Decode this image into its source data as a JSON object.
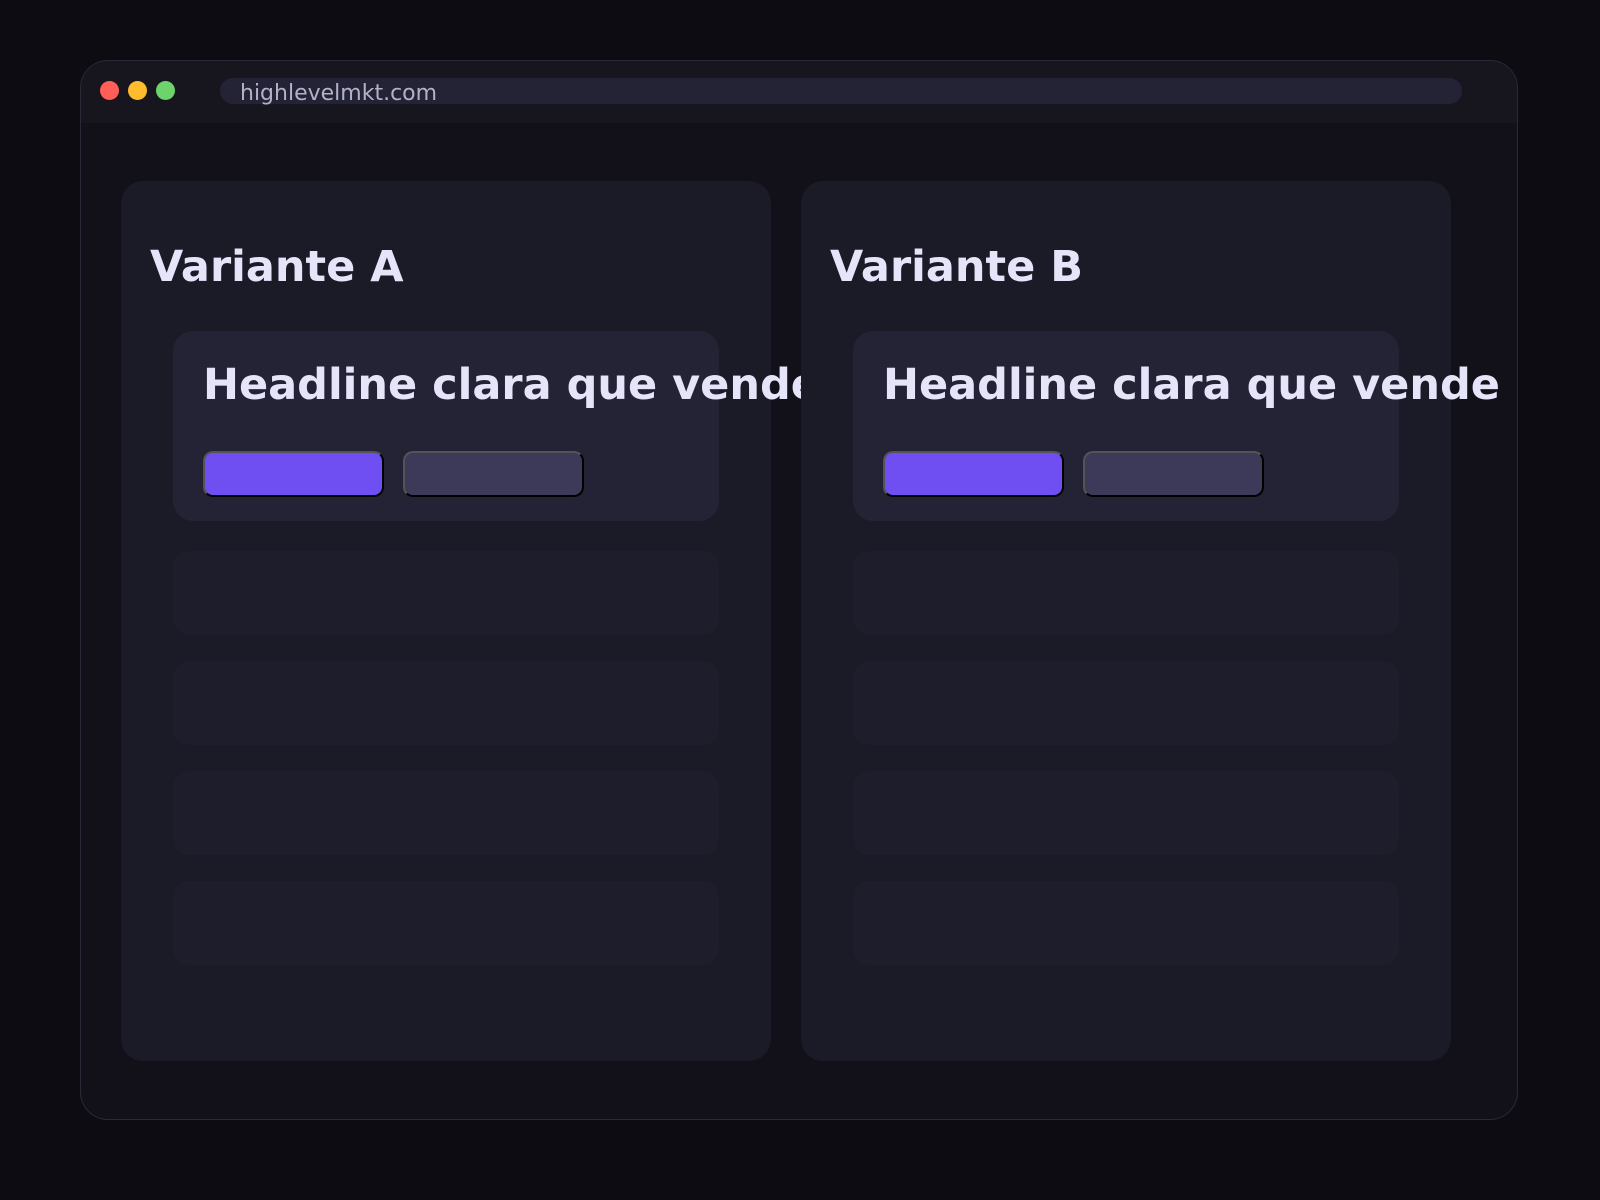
{
  "browser": {
    "url": "highlevelmkt.com",
    "traffic_lights": [
      "close",
      "minimize",
      "maximize"
    ],
    "colors": {
      "close": "#ff5f57",
      "minimize": "#ffbd2e",
      "maximize": "#6ed36b"
    }
  },
  "variants": [
    {
      "title": "Variante A",
      "headline": "Headline clara que vende",
      "primary_cta_label": "",
      "secondary_cta_label": ""
    },
    {
      "title": "Variante B",
      "headline": "Headline clara que vende",
      "primary_cta_label": "",
      "secondary_cta_label": ""
    }
  ],
  "colors": {
    "accent": "#6f4ef2",
    "secondary_button": "#3c3a58",
    "text": "#e6e4f9",
    "background": "#0d0c13"
  }
}
